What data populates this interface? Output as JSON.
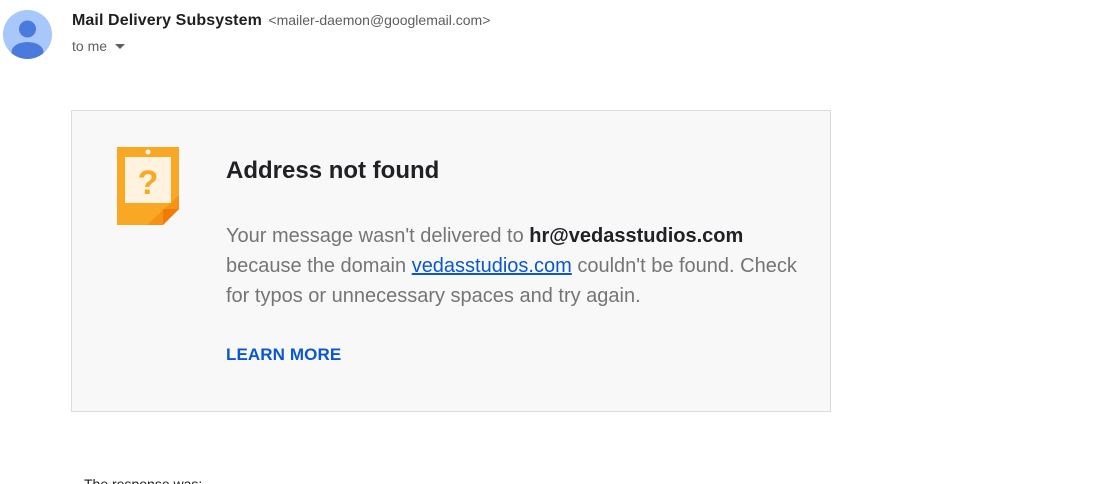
{
  "header": {
    "sender_name": "Mail Delivery Subsystem",
    "sender_email": "<mailer-daemon@googlemail.com>",
    "to_label": "to me",
    "avatar_icon": "person-avatar-icon",
    "caret_icon": "caret-down-icon",
    "avatar_color": "#a8c7fa"
  },
  "card": {
    "icon": "warning-note-icon",
    "icon_color": "#f9a825",
    "title": "Address not found",
    "body_part1": "Your message wasn't delivered to ",
    "recipient": "hr@vedasstudios.com",
    "body_part2": " because the domain ",
    "domain_link": "vedasstudios.com",
    "body_part3": " couldn't be found. Check for typos or unnecessary spaces and try again.",
    "learn_more": "LEARN MORE",
    "link_color": "#0b57d0"
  },
  "footer": {
    "response_label": "The response was:"
  }
}
